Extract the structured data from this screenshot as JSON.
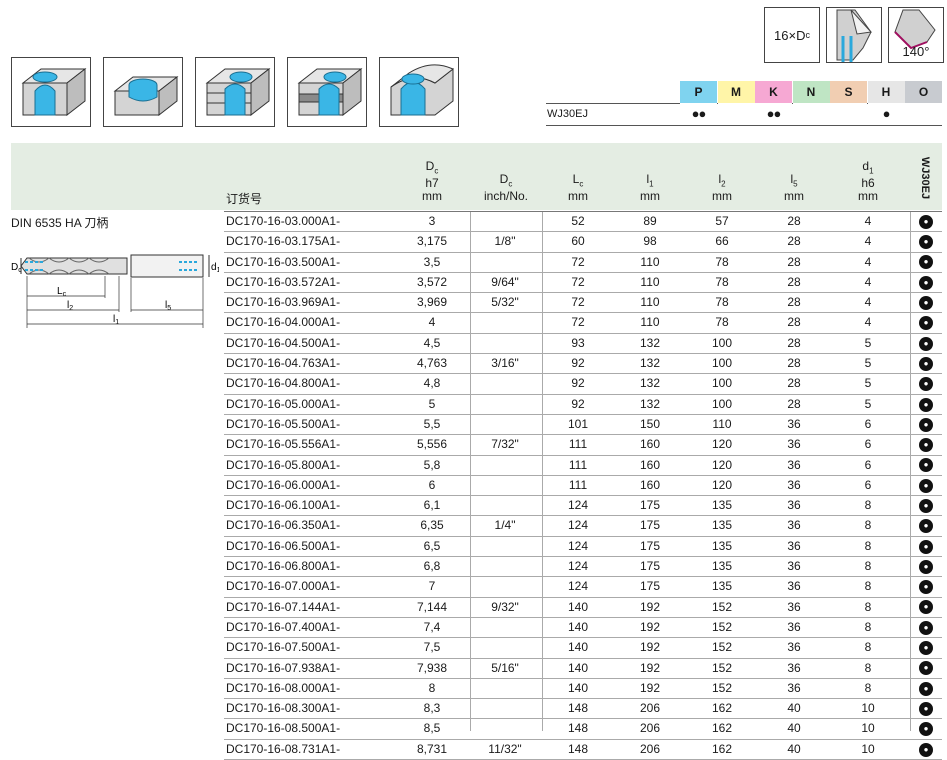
{
  "grade": "WJ30EJ",
  "symbols": {
    "length_label": "16×D",
    "length_sub": "c",
    "point_angle": "140°"
  },
  "materials": [
    {
      "letter": "P",
      "color": "#7fd3ef",
      "mark": "●●"
    },
    {
      "letter": "M",
      "color": "#fff5a8",
      "mark": ""
    },
    {
      "letter": "K",
      "color": "#f6a8d3",
      "mark": "●●"
    },
    {
      "letter": "N",
      "color": "#bfe5c4",
      "mark": ""
    },
    {
      "letter": "S",
      "color": "#f1ceb2",
      "mark": ""
    },
    {
      "letter": "H",
      "color": "#e6e6e6",
      "mark": "●"
    },
    {
      "letter": "O",
      "color": "#c8cbd0",
      "mark": ""
    }
  ],
  "shank": {
    "title": "DIN 6535 HA 刀柄",
    "dim_dc": "D",
    "dim_dc_sub": "c",
    "dim_d1": "d",
    "dim_d1_sub": "1",
    "dim_lc": "L",
    "dim_lc_sub": "c",
    "dim_l2": "l",
    "dim_l2_sub": "2",
    "dim_l5": "l",
    "dim_l5_sub": "5",
    "dim_l1": "l",
    "dim_l1_sub": "1"
  },
  "table": {
    "code_title": "订货号",
    "headers": {
      "dc_main": "D",
      "dc_sub": "c",
      "dc_tol": "h7",
      "dc_unit": "mm",
      "inch_main": "D",
      "inch_sub": "c",
      "inch_unit": "inch/No.",
      "lc_main": "L",
      "lc_sub": "c",
      "lc_unit": "mm",
      "l1_main": "l",
      "l1_sub": "1",
      "l1_unit": "mm",
      "l2_main": "l",
      "l2_sub": "2",
      "l2_unit": "mm",
      "l5_main": "l",
      "l5_sub": "5",
      "l5_unit": "mm",
      "d1_main": "d",
      "d1_sub": "1",
      "d1_tol": "h6",
      "d1_unit": "mm",
      "grade_vert": "WJ30EJ"
    },
    "avail_glyph": "●",
    "rows": [
      {
        "code": "DC170-16-03.000A1-",
        "dc": "3",
        "inch": "",
        "lc": "52",
        "l1": "89",
        "l2": "57",
        "l5": "28",
        "d1": "4"
      },
      {
        "code": "DC170-16-03.175A1-",
        "dc": "3,175",
        "inch": "1/8\"",
        "lc": "60",
        "l1": "98",
        "l2": "66",
        "l5": "28",
        "d1": "4"
      },
      {
        "code": "DC170-16-03.500A1-",
        "dc": "3,5",
        "inch": "",
        "lc": "72",
        "l1": "110",
        "l2": "78",
        "l5": "28",
        "d1": "4"
      },
      {
        "code": "DC170-16-03.572A1-",
        "dc": "3,572",
        "inch": "9/64\"",
        "lc": "72",
        "l1": "110",
        "l2": "78",
        "l5": "28",
        "d1": "4"
      },
      {
        "code": "DC170-16-03.969A1-",
        "dc": "3,969",
        "inch": "5/32\"",
        "lc": "72",
        "l1": "110",
        "l2": "78",
        "l5": "28",
        "d1": "4"
      },
      {
        "code": "DC170-16-04.000A1-",
        "dc": "4",
        "inch": "",
        "lc": "72",
        "l1": "110",
        "l2": "78",
        "l5": "28",
        "d1": "4"
      },
      {
        "code": "DC170-16-04.500A1-",
        "dc": "4,5",
        "inch": "",
        "lc": "93",
        "l1": "132",
        "l2": "100",
        "l5": "28",
        "d1": "5"
      },
      {
        "code": "DC170-16-04.763A1-",
        "dc": "4,763",
        "inch": "3/16\"",
        "lc": "92",
        "l1": "132",
        "l2": "100",
        "l5": "28",
        "d1": "5"
      },
      {
        "code": "DC170-16-04.800A1-",
        "dc": "4,8",
        "inch": "",
        "lc": "92",
        "l1": "132",
        "l2": "100",
        "l5": "28",
        "d1": "5"
      },
      {
        "code": "DC170-16-05.000A1-",
        "dc": "5",
        "inch": "",
        "lc": "92",
        "l1": "132",
        "l2": "100",
        "l5": "28",
        "d1": "5"
      },
      {
        "code": "DC170-16-05.500A1-",
        "dc": "5,5",
        "inch": "",
        "lc": "101",
        "l1": "150",
        "l2": "110",
        "l5": "36",
        "d1": "6"
      },
      {
        "code": "DC170-16-05.556A1-",
        "dc": "5,556",
        "inch": "7/32\"",
        "lc": "111",
        "l1": "160",
        "l2": "120",
        "l5": "36",
        "d1": "6"
      },
      {
        "code": "DC170-16-05.800A1-",
        "dc": "5,8",
        "inch": "",
        "lc": "111",
        "l1": "160",
        "l2": "120",
        "l5": "36",
        "d1": "6"
      },
      {
        "code": "DC170-16-06.000A1-",
        "dc": "6",
        "inch": "",
        "lc": "111",
        "l1": "160",
        "l2": "120",
        "l5": "36",
        "d1": "6"
      },
      {
        "code": "DC170-16-06.100A1-",
        "dc": "6,1",
        "inch": "",
        "lc": "124",
        "l1": "175",
        "l2": "135",
        "l5": "36",
        "d1": "8"
      },
      {
        "code": "DC170-16-06.350A1-",
        "dc": "6,35",
        "inch": "1/4\"",
        "lc": "124",
        "l1": "175",
        "l2": "135",
        "l5": "36",
        "d1": "8"
      },
      {
        "code": "DC170-16-06.500A1-",
        "dc": "6,5",
        "inch": "",
        "lc": "124",
        "l1": "175",
        "l2": "135",
        "l5": "36",
        "d1": "8"
      },
      {
        "code": "DC170-16-06.800A1-",
        "dc": "6,8",
        "inch": "",
        "lc": "124",
        "l1": "175",
        "l2": "135",
        "l5": "36",
        "d1": "8"
      },
      {
        "code": "DC170-16-07.000A1-",
        "dc": "7",
        "inch": "",
        "lc": "124",
        "l1": "175",
        "l2": "135",
        "l5": "36",
        "d1": "8"
      },
      {
        "code": "DC170-16-07.144A1-",
        "dc": "7,144",
        "inch": "9/32\"",
        "lc": "140",
        "l1": "192",
        "l2": "152",
        "l5": "36",
        "d1": "8"
      },
      {
        "code": "DC170-16-07.400A1-",
        "dc": "7,4",
        "inch": "",
        "lc": "140",
        "l1": "192",
        "l2": "152",
        "l5": "36",
        "d1": "8"
      },
      {
        "code": "DC170-16-07.500A1-",
        "dc": "7,5",
        "inch": "",
        "lc": "140",
        "l1": "192",
        "l2": "152",
        "l5": "36",
        "d1": "8"
      },
      {
        "code": "DC170-16-07.938A1-",
        "dc": "7,938",
        "inch": "5/16\"",
        "lc": "140",
        "l1": "192",
        "l2": "152",
        "l5": "36",
        "d1": "8"
      },
      {
        "code": "DC170-16-08.000A1-",
        "dc": "8",
        "inch": "",
        "lc": "140",
        "l1": "192",
        "l2": "152",
        "l5": "36",
        "d1": "8"
      },
      {
        "code": "DC170-16-08.300A1-",
        "dc": "8,3",
        "inch": "",
        "lc": "148",
        "l1": "206",
        "l2": "162",
        "l5": "40",
        "d1": "10"
      },
      {
        "code": "DC170-16-08.500A1-",
        "dc": "8,5",
        "inch": "",
        "lc": "148",
        "l1": "206",
        "l2": "162",
        "l5": "40",
        "d1": "10"
      },
      {
        "code": "DC170-16-08.731A1-",
        "dc": "8,731",
        "inch": "11/32\"",
        "lc": "148",
        "l1": "206",
        "l2": "162",
        "l5": "40",
        "d1": "10"
      }
    ]
  }
}
